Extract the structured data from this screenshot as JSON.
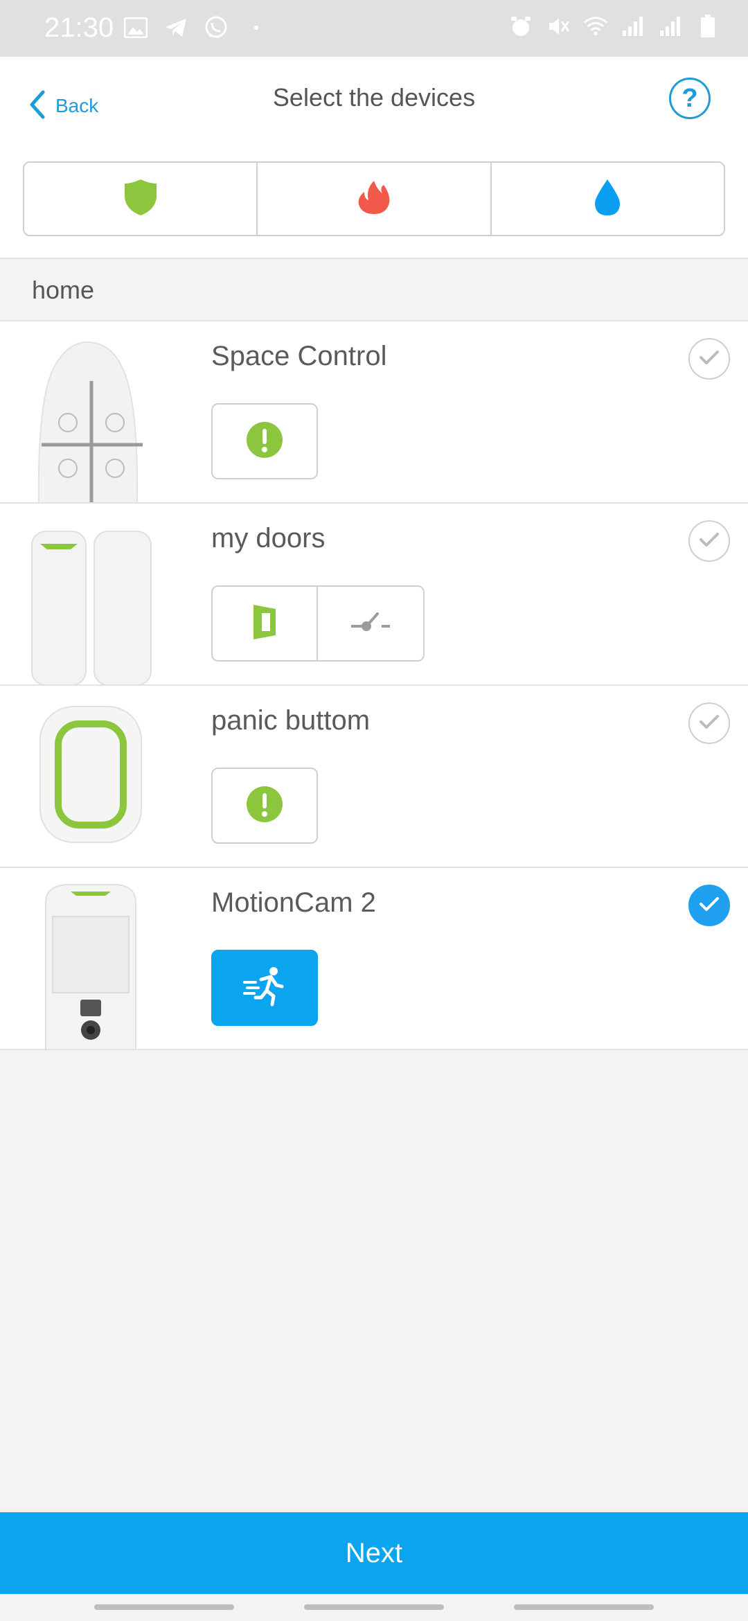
{
  "status_bar": {
    "time": "21:30",
    "left_icons": [
      "image-icon",
      "telegram-icon",
      "viber-icon",
      "dot-icon"
    ],
    "right_icons": [
      "alarm-icon",
      "mute-icon",
      "wifi-icon",
      "signal-icon",
      "signal-roaming-icon",
      "battery-icon"
    ]
  },
  "header": {
    "back_label": "Back",
    "title": "Select the devices",
    "help_label": "?"
  },
  "filter": {
    "segments": [
      {
        "icon": "shield-icon",
        "color": "#8cc63f"
      },
      {
        "icon": "flame-icon",
        "color": "#f15a4a"
      },
      {
        "icon": "drop-icon",
        "color": "#0a9ff0"
      }
    ]
  },
  "section": {
    "label": "home"
  },
  "devices": [
    {
      "name": "Space Control",
      "image": "space-control-icon",
      "selected": false,
      "chips": [
        "alert-icon"
      ]
    },
    {
      "name": "my doors",
      "image": "door-protect-icon",
      "selected": false,
      "chips": [
        "door-icon",
        "switch-icon"
      ]
    },
    {
      "name": "panic buttom",
      "image": "panic-button-icon",
      "selected": false,
      "chips": [
        "alert-icon"
      ]
    },
    {
      "name": "MotionCam 2",
      "image": "motioncam-icon",
      "selected": true,
      "chips": [
        "running-person-icon"
      ]
    }
  ],
  "colors": {
    "accent": "#0aa4ef",
    "green": "#8cc63f",
    "text": "#555555"
  },
  "footer": {
    "next_label": "Next"
  }
}
